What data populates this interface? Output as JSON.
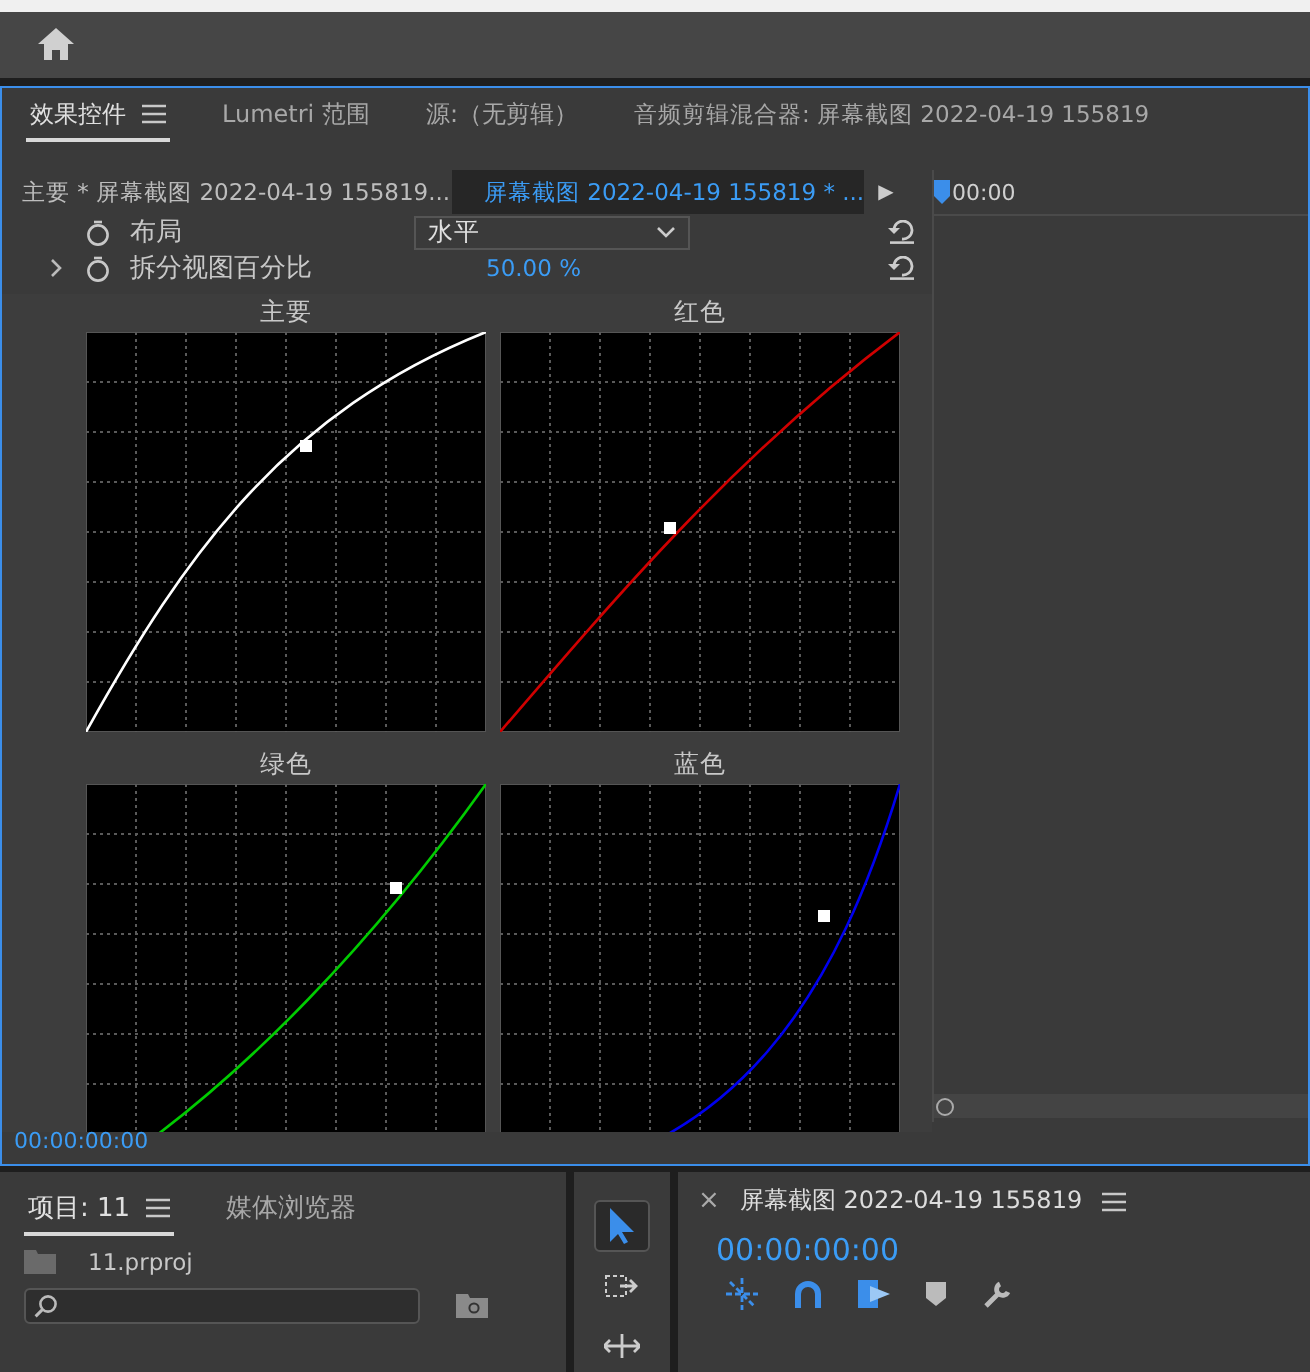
{
  "panel_tabs": [
    {
      "label": "效果控件",
      "selected": true
    },
    {
      "label": "Lumetri 范围",
      "selected": false
    },
    {
      "label": "源:（无剪辑）",
      "selected": false
    },
    {
      "label": "音频剪辑混合器: 屏幕截图 2022-04-19 155819",
      "selected": false
    }
  ],
  "clip_bar": {
    "master": "主要 * 屏幕截图 2022-04-19 155819...",
    "clip": "屏幕截图 2022-04-19 155819 * ...",
    "arrow": "▶",
    "timecode": "00:00"
  },
  "properties": [
    {
      "label": "布局",
      "kind": "dropdown",
      "value": "水平",
      "expandable": false
    },
    {
      "label": "拆分视图百分比",
      "kind": "number",
      "value": "50.00 %",
      "expandable": true
    }
  ],
  "curves": [
    {
      "title": "主要",
      "color": "#ffffff",
      "kind": "steep"
    },
    {
      "title": "红色",
      "color": "#d00000",
      "kind": "gentle"
    },
    {
      "title": "绿色",
      "color": "#00cc00",
      "kind": "sag"
    },
    {
      "title": "蓝色",
      "color": "#0000ee",
      "kind": "deep-sag"
    }
  ],
  "timecode": "00:00:00:00",
  "project_tabs": [
    {
      "label": "项目: 11",
      "selected": true
    },
    {
      "label": "媒体浏览器",
      "selected": false
    }
  ],
  "project_file": "11.prproj",
  "tools": [
    {
      "kind": "select",
      "selected": true
    },
    {
      "kind": "track-select",
      "selected": false
    },
    {
      "kind": "ripple",
      "selected": false
    }
  ],
  "sequence": {
    "close": "×",
    "title": "屏幕截图 2022-04-19 155819",
    "timecode": "00:00:00:00"
  }
}
